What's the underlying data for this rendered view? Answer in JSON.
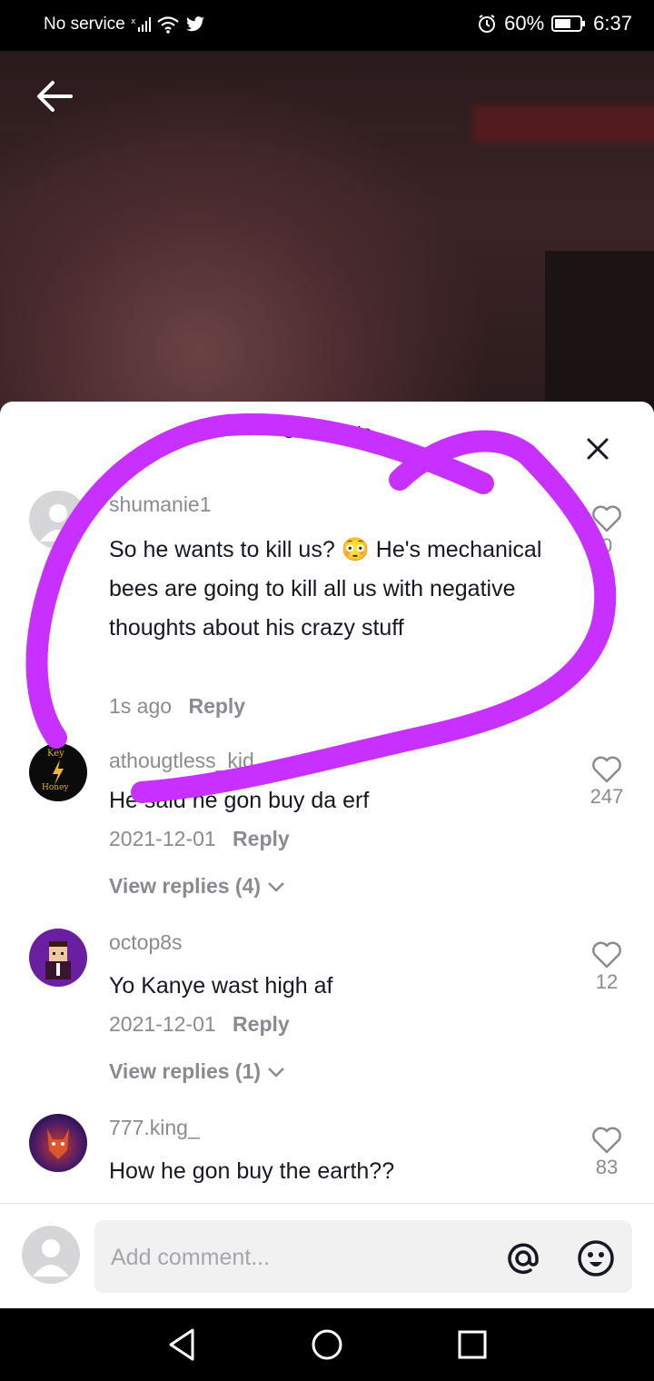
{
  "status_bar": {
    "carrier": "No service",
    "battery": "60%",
    "time": "6:37"
  },
  "sheet": {
    "title": "Comments"
  },
  "comments": [
    {
      "username": "shumanie1",
      "text": "So he wants to kill us? 😳 He's mechanical bees are going to kill all us with negative thoughts about his crazy stuff",
      "time": "1s ago",
      "reply": "Reply",
      "likes": "0"
    },
    {
      "username": "athougtless_kid",
      "avatar_text_top": "Key",
      "avatar_text_bottom": "Honey",
      "text": "He said he gon buy da erf",
      "time": "2021-12-01",
      "reply": "Reply",
      "likes": "247",
      "view_replies": "View replies (4)"
    },
    {
      "username": "octop8s",
      "text": "Yo Kanye wast high af",
      "time": "2021-12-01",
      "reply": "Reply",
      "likes": "12",
      "view_replies": "View replies (1)"
    },
    {
      "username": "777.king_",
      "text": "How he gon buy the earth??",
      "likes": "83"
    }
  ],
  "input": {
    "placeholder": "Add comment..."
  },
  "colors": {
    "annotation": "#c830ff",
    "text_primary": "#161823",
    "text_secondary": "#8a8b91"
  },
  "icons": {
    "back": "arrow-left-icon",
    "close": "close-icon",
    "like": "heart-outline-icon",
    "mention": "at-icon",
    "emoji": "emoji-icon",
    "nav_back": "triangle-back-icon",
    "nav_home": "circle-home-icon",
    "nav_recents": "square-recents-icon"
  }
}
